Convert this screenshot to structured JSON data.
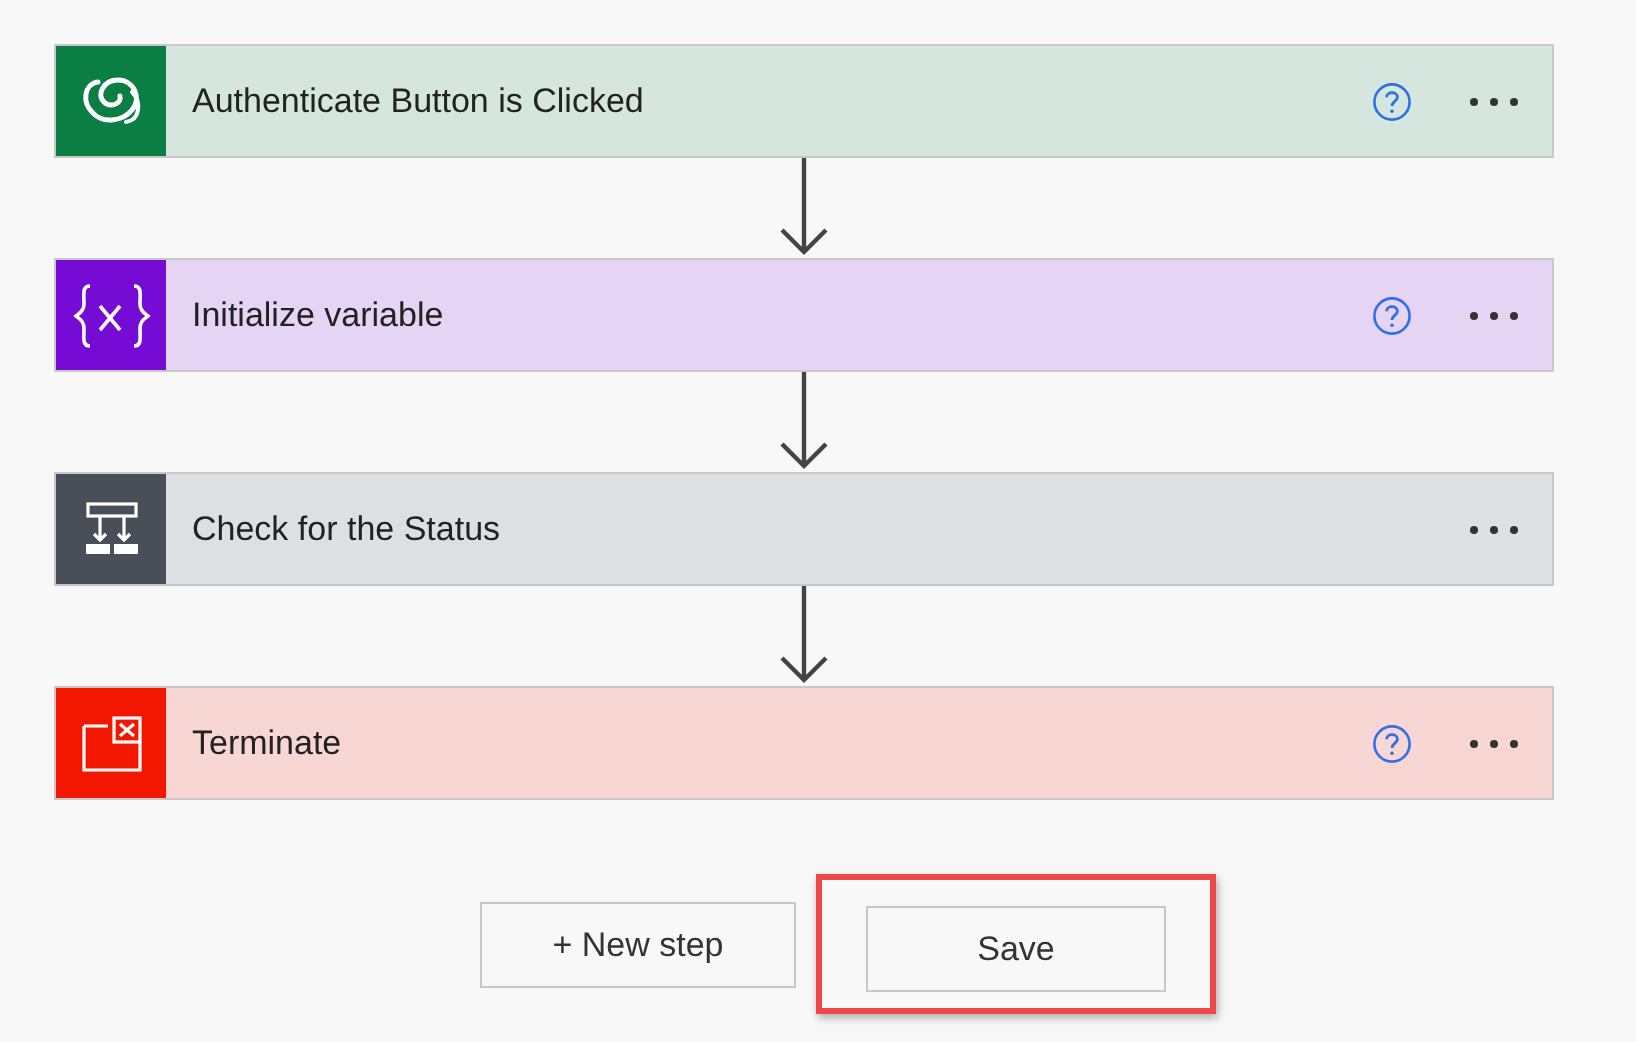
{
  "steps": [
    {
      "kind": "dataverse",
      "title": "Authenticate Button is Clicked",
      "help": true,
      "color": "#0b7f43"
    },
    {
      "kind": "variable",
      "title": "Initialize variable",
      "help": true,
      "color": "#770bd6"
    },
    {
      "kind": "condition",
      "title": "Check for the Status",
      "help": false,
      "color": "#484f58"
    },
    {
      "kind": "terminate",
      "title": "Terminate",
      "help": true,
      "color": "#f41700"
    }
  ],
  "buttons": [
    {
      "label": "+ New step",
      "highlighted": false
    },
    {
      "label": "Save",
      "highlighted": true
    }
  ]
}
